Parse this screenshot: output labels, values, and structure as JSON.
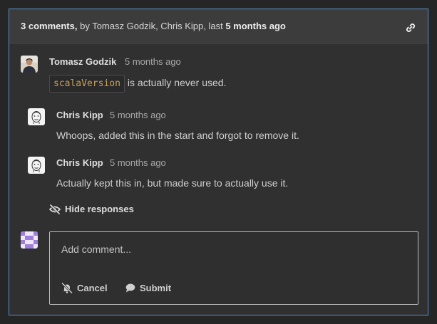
{
  "header": {
    "count_label": "3 comments,",
    "by_text": " by Tomasz Godzik, Chris Kipp, last ",
    "last_time": "5 months ago",
    "link_icon": "link-icon"
  },
  "comments": [
    {
      "author": "Tomasz Godzik",
      "time": "5 months ago",
      "code": "scalaVersion",
      "text": "is actually never used.",
      "avatar": "photo-avatar"
    },
    {
      "author": "Chris Kipp",
      "time": "5 months ago",
      "text": "Whoops, added this in the start and forgot to remove it.",
      "avatar": "sketch-face-avatar"
    },
    {
      "author": "Chris Kipp",
      "time": "5 months ago",
      "text": "Actually kept this in, but made sure to actually use it.",
      "avatar": "sketch-face-avatar"
    }
  ],
  "hide_responses": {
    "label": "Hide responses",
    "icon": "eye-slash-icon"
  },
  "new_comment": {
    "placeholder": "Add comment...",
    "cancel_label": "Cancel",
    "cancel_icon": "bell-slash-icon",
    "submit_label": "Submit",
    "submit_icon": "speech-bubble-icon",
    "avatar": "identicon-avatar"
  },
  "colors": {
    "panel_border": "#5a8fc7",
    "header_bg": "#3c3c3c",
    "body_bg": "#303030",
    "code_text": "#c9a15a"
  }
}
